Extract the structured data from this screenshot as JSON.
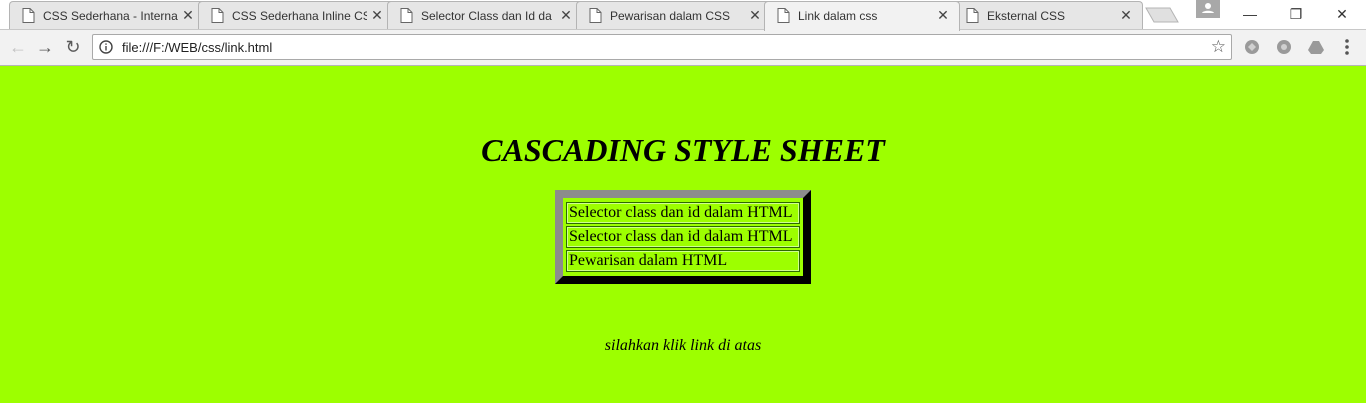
{
  "browser": {
    "tabs": [
      {
        "title": "CSS Sederhana - Interna",
        "active": false
      },
      {
        "title": "CSS Sederhana Inline CS",
        "active": false
      },
      {
        "title": "Selector Class dan Id da",
        "active": false
      },
      {
        "title": "Pewarisan dalam CSS",
        "active": false
      },
      {
        "title": "Link dalam css",
        "active": true
      },
      {
        "title": "Eksternal CSS",
        "active": false
      }
    ],
    "close_glyph": "✕",
    "window_controls": {
      "minimize": "—",
      "restore": "❐",
      "close": "✕"
    },
    "toolbar": {
      "back_glyph": "←",
      "forward_glyph": "→",
      "reload_glyph": "↻",
      "url": "file:///F:/WEB/css/link.html",
      "star_glyph": "☆"
    },
    "icons": {
      "tab_favicon": "page-icon",
      "info": "info-icon",
      "extensions": [
        "extension-icon",
        "extension-icon",
        "drive-icon"
      ],
      "menu": "menu-dots-icon",
      "profile": "profile-icon"
    }
  },
  "page": {
    "background_color": "#9dff00",
    "heading": "CASCADING STYLE SHEET",
    "links": [
      "Selector class dan id dalam HTML",
      "Selector class dan id dalam HTML",
      "Pewarisan dalam HTML"
    ],
    "note": "silahkan klik link di atas"
  }
}
